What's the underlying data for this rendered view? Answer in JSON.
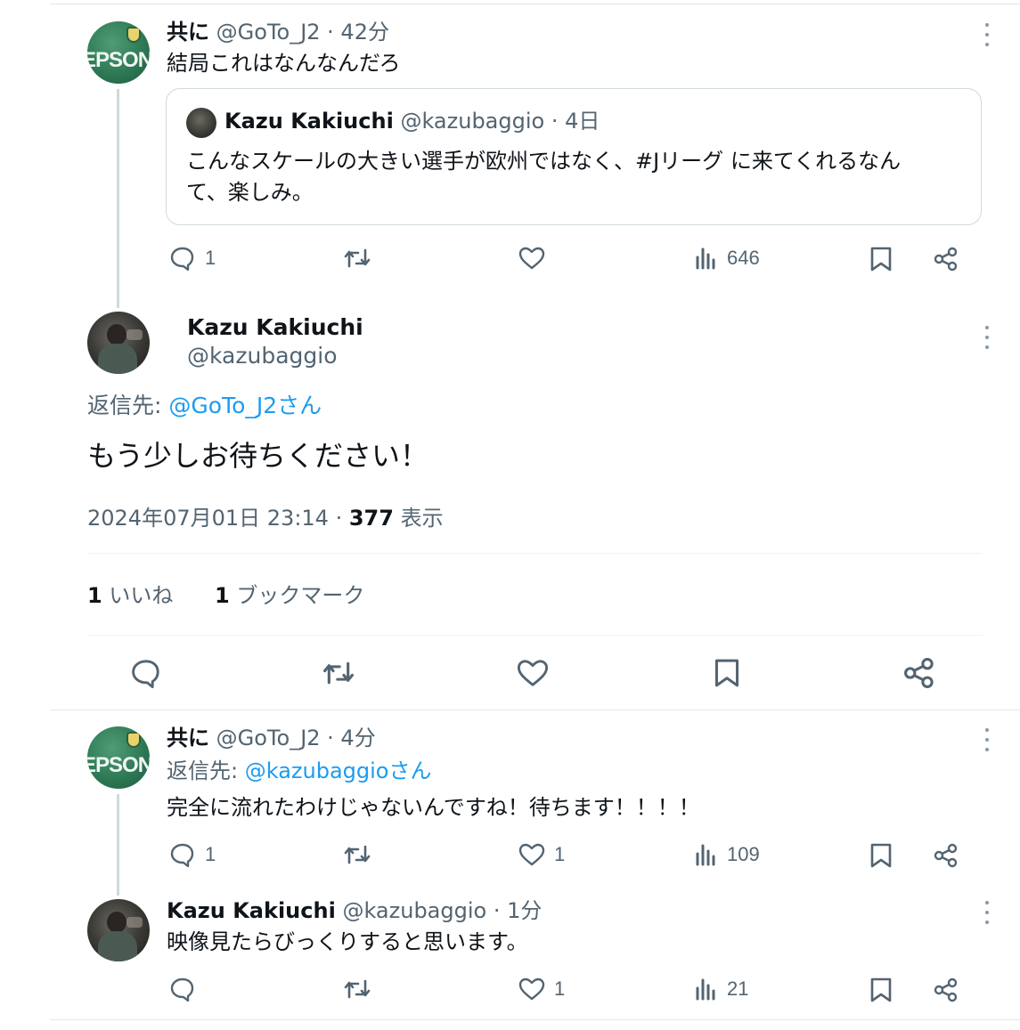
{
  "tweet1": {
    "author_name": "共に",
    "handle_time": "@GoTo_J2 · 42分",
    "text": "結局これはなんなんだろ",
    "quote": {
      "author_name": "Kazu Kakiuchi",
      "handle_time": "@kazubaggio · 4日",
      "text_line1": "こんなスケールの大きい選手が欧州ではなく、#Jリーグ に来てくれるなん",
      "text_line2": "て、楽しみ。"
    },
    "actions": {
      "reply": "1",
      "retweet": "",
      "like": "",
      "views": "646"
    }
  },
  "main_tweet": {
    "author_name": "Kazu Kakiuchi",
    "handle": "@kazubaggio",
    "reply_prefix": "返信先: ",
    "reply_to": "@GoTo_J2さん",
    "text": "もう少しお待ちください！",
    "timestamp": "2024年07月01日 23:14 · ",
    "views_count": "377",
    "views_label": " 表示",
    "likes_count": "1",
    "likes_label": " いいね",
    "bookmarks_count": "1",
    "bookmarks_label": " ブックマーク"
  },
  "tweet3": {
    "author_name": "共に",
    "handle_time": "@GoTo_J2 · 4分",
    "reply_prefix": "返信先: ",
    "reply_to": "@kazubaggioさん",
    "text": "完全に流れたわけじゃないんですね！待ちます！！！！",
    "actions": {
      "reply": "1",
      "retweet": "",
      "like": "1",
      "views": "109"
    }
  },
  "tweet4": {
    "author_name": "Kazu Kakiuchi",
    "handle_time": "@kazubaggio · 1分",
    "text": "映像見たらびっくりすると思います。",
    "actions": {
      "reply": "",
      "retweet": "",
      "like": "1",
      "views": "21"
    }
  },
  "avatars": {
    "goto_j2_text": "EPSON"
  },
  "icons": [
    "reply-icon",
    "retweet-icon",
    "like-icon",
    "views-icon",
    "bookmark-icon",
    "share-icon",
    "more-icon"
  ],
  "colors": {
    "link": "#1d9bf0",
    "muted": "#536471",
    "text": "#0f1419",
    "border": "#cfd9de"
  }
}
